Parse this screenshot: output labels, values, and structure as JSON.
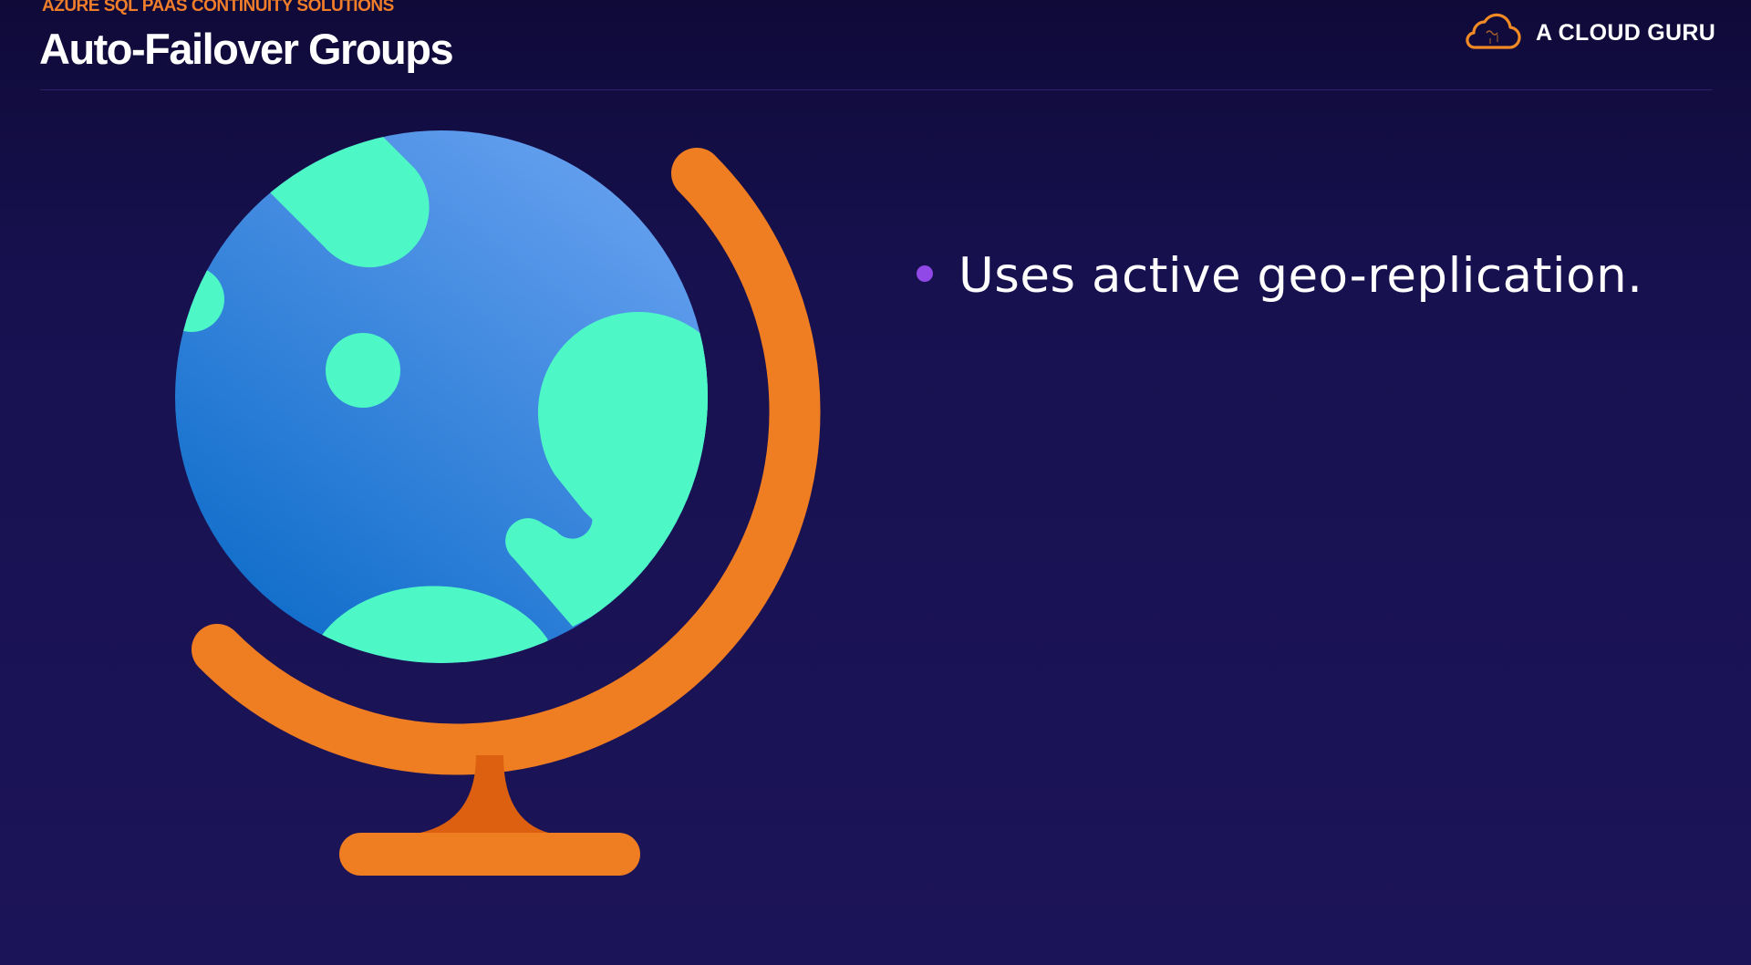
{
  "slide": {
    "eyebrow": "AZURE SQL PAAS CONTINUITY SOLUTIONS",
    "title": "Auto-Failover Groups",
    "bullets": [
      {
        "text": "Uses active geo-replication."
      }
    ]
  },
  "brand": {
    "name": "A CLOUD GURU",
    "icon": "cloud-logo-icon"
  },
  "illustration": {
    "icon": "globe-icon"
  },
  "colors": {
    "background": "#1a1354",
    "accent_orange": "#ef7d22",
    "bullet_purple": "#9049e6",
    "ocean_blue": "#3f8ee2",
    "land_green": "#4ef8c6"
  }
}
